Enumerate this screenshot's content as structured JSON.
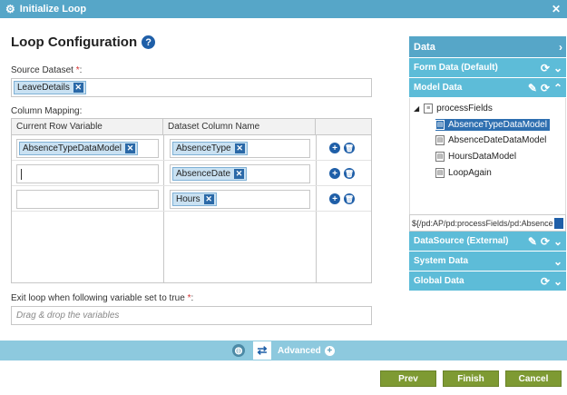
{
  "window": {
    "title": "Initialize Loop"
  },
  "main": {
    "heading": "Loop Configuration",
    "source_label": "Source Dataset ",
    "source_required": "*",
    "source_colon": ":",
    "source_tag": "LeaveDetails",
    "mapping_label": "Column Mapping:",
    "columns": [
      "Current Row Variable",
      "Dataset Column Name"
    ],
    "rows": [
      {
        "variable": "AbsenceTypeDataModel",
        "column": "AbsenceType"
      },
      {
        "variable": "",
        "column": "AbsenceDate"
      },
      {
        "variable": "",
        "column": "Hours"
      }
    ],
    "exit_label": "Exit loop when following variable set to true ",
    "exit_required": "*",
    "exit_colon": ":",
    "exit_placeholder": "Drag & drop the variables"
  },
  "data_panel": {
    "title": "Data",
    "form_data": "Form Data (Default)",
    "model_data": "Model Data",
    "tree_root": "processFields",
    "tree_items": [
      "AbsenceTypeDataModel",
      "AbsenceDateDataModel",
      "HoursDataModel",
      "LoopAgain"
    ],
    "path_value": "${/pd:AP/pd:processFields/pd:Absence",
    "datasource": "DataSource (External)",
    "system_data": "System Data",
    "global_data": "Global Data"
  },
  "footer": {
    "advanced": "Advanced",
    "prev": "Prev",
    "finish": "Finish",
    "cancel": "Cancel"
  }
}
